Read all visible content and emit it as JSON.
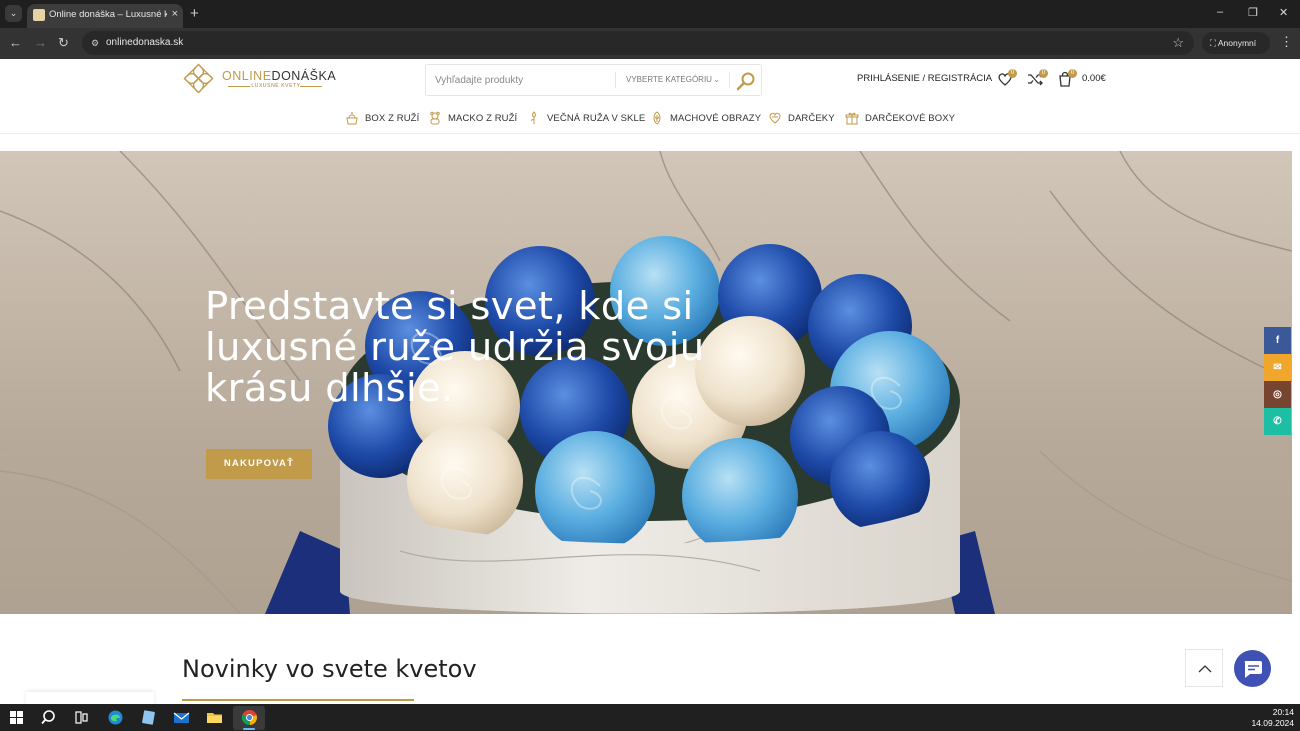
{
  "browser": {
    "tab_title": "Online donáška – Luxusné kvety",
    "tab_close": "×",
    "new_tab": "+",
    "url": "onlinedonaska.sk",
    "profile": "Anonymní",
    "window_controls": [
      "–",
      "❐",
      "✕"
    ]
  },
  "site": {
    "logo_online": "ONLINE",
    "logo_donaska": "DONÁŠKA",
    "logo_tagline": "LUXUSNÉ KVETY",
    "search_placeholder": "Vyhľadajte produkty",
    "category_select": "VYBERTE KATEGÓRIU",
    "login": "PRIHLÁSENIE / REGISTRÁCIA",
    "wishlist_count": "0",
    "compare_count": "0",
    "cart_count": "0",
    "cart_total": "0.00€",
    "brand_color": "#c19a4a"
  },
  "categories": [
    {
      "label": "BOX Z RUŽÍ",
      "icon": "rose-box-icon"
    },
    {
      "label": "MACKO Z RUŽÍ",
      "icon": "teddy-bear-icon"
    },
    {
      "label": "VEČNÁ RUŽA V SKLE",
      "icon": "rose-dome-icon"
    },
    {
      "label": "MACHOVÉ OBRAZY",
      "icon": "moss-frame-icon"
    },
    {
      "label": "DARČEKY",
      "icon": "heart-gift-icon"
    },
    {
      "label": "DARČEKOVÉ BOXY",
      "icon": "gift-box-icon"
    }
  ],
  "hero": {
    "title": "Predstavte si svet, kde si luxusné ruže udržia svoju krásu dlhšie.",
    "cta": "NAKUPOVAŤ"
  },
  "social": [
    {
      "name": "facebook",
      "glyph": "f",
      "color": "#3b5998"
    },
    {
      "name": "email",
      "glyph": "✉",
      "color": "#f0a52b"
    },
    {
      "name": "instagram",
      "glyph": "◎",
      "color": "#774430"
    },
    {
      "name": "whatsapp",
      "glyph": "✆",
      "color": "#1ebea5"
    }
  ],
  "section": {
    "title": "Novinky vo svete kvetov"
  },
  "taskbar": {
    "time": "20:14",
    "date": "14.09.2024"
  }
}
